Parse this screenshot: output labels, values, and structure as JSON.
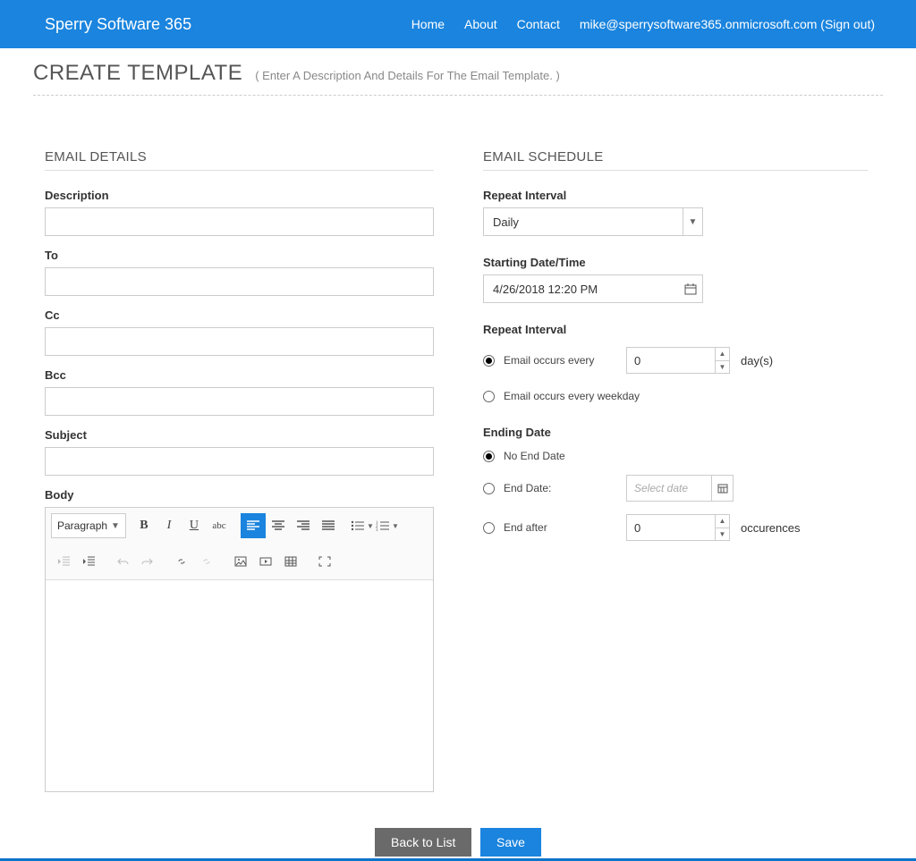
{
  "brand": "Sperry Software 365",
  "nav": {
    "home": "Home",
    "about": "About",
    "contact": "Contact",
    "user": "mike@sperrysoftware365.onmicrosoft.com (Sign out)"
  },
  "header": {
    "title": "CREATE TEMPLATE",
    "subtitle": "( Enter A Description And Details For The Email Template. )"
  },
  "emailDetails": {
    "section": "EMAIL DETAILS",
    "description": {
      "label": "Description",
      "value": ""
    },
    "to": {
      "label": "To",
      "value": ""
    },
    "cc": {
      "label": "Cc",
      "value": ""
    },
    "bcc": {
      "label": "Bcc",
      "value": ""
    },
    "subject": {
      "label": "Subject",
      "value": ""
    },
    "body": {
      "label": "Body"
    },
    "paragraph": "Paragraph"
  },
  "schedule": {
    "section": "EMAIL SCHEDULE",
    "repeatInterval": {
      "label": "Repeat Interval",
      "value": "Daily"
    },
    "startDate": {
      "label": "Starting Date/Time",
      "value": "4/26/2018 12:20 PM"
    },
    "repeatInterval2": {
      "label": "Repeat Interval"
    },
    "occursEvery": {
      "label": "Email occurs every",
      "value": "0",
      "unit": "day(s)"
    },
    "occursWeekday": {
      "label": "Email occurs every weekday"
    },
    "ending": {
      "label": "Ending Date",
      "noEnd": "No End Date",
      "endDate": "End Date:",
      "endDatePlaceholder": "Select date",
      "endAfter": "End after",
      "endAfterValue": "0",
      "endAfterUnit": "occurences"
    }
  },
  "footer": {
    "back": "Back to List",
    "save": "Save"
  }
}
